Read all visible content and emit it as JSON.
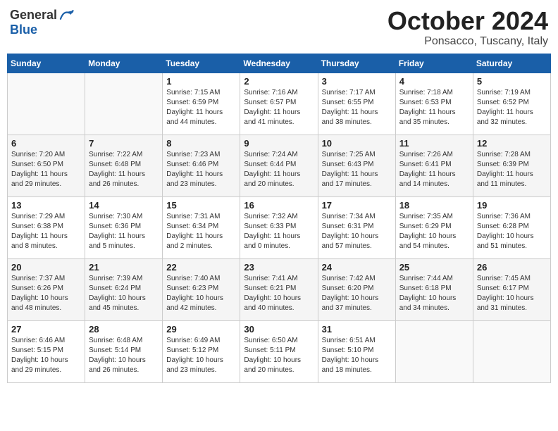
{
  "header": {
    "logo_general": "General",
    "logo_blue": "Blue",
    "month": "October 2024",
    "location": "Ponsacco, Tuscany, Italy"
  },
  "days_of_week": [
    "Sunday",
    "Monday",
    "Tuesday",
    "Wednesday",
    "Thursday",
    "Friday",
    "Saturday"
  ],
  "weeks": [
    [
      {
        "day": "",
        "info": ""
      },
      {
        "day": "",
        "info": ""
      },
      {
        "day": "1",
        "info": "Sunrise: 7:15 AM\nSunset: 6:59 PM\nDaylight: 11 hours and 44 minutes."
      },
      {
        "day": "2",
        "info": "Sunrise: 7:16 AM\nSunset: 6:57 PM\nDaylight: 11 hours and 41 minutes."
      },
      {
        "day": "3",
        "info": "Sunrise: 7:17 AM\nSunset: 6:55 PM\nDaylight: 11 hours and 38 minutes."
      },
      {
        "day": "4",
        "info": "Sunrise: 7:18 AM\nSunset: 6:53 PM\nDaylight: 11 hours and 35 minutes."
      },
      {
        "day": "5",
        "info": "Sunrise: 7:19 AM\nSunset: 6:52 PM\nDaylight: 11 hours and 32 minutes."
      }
    ],
    [
      {
        "day": "6",
        "info": "Sunrise: 7:20 AM\nSunset: 6:50 PM\nDaylight: 11 hours and 29 minutes."
      },
      {
        "day": "7",
        "info": "Sunrise: 7:22 AM\nSunset: 6:48 PM\nDaylight: 11 hours and 26 minutes."
      },
      {
        "day": "8",
        "info": "Sunrise: 7:23 AM\nSunset: 6:46 PM\nDaylight: 11 hours and 23 minutes."
      },
      {
        "day": "9",
        "info": "Sunrise: 7:24 AM\nSunset: 6:44 PM\nDaylight: 11 hours and 20 minutes."
      },
      {
        "day": "10",
        "info": "Sunrise: 7:25 AM\nSunset: 6:43 PM\nDaylight: 11 hours and 17 minutes."
      },
      {
        "day": "11",
        "info": "Sunrise: 7:26 AM\nSunset: 6:41 PM\nDaylight: 11 hours and 14 minutes."
      },
      {
        "day": "12",
        "info": "Sunrise: 7:28 AM\nSunset: 6:39 PM\nDaylight: 11 hours and 11 minutes."
      }
    ],
    [
      {
        "day": "13",
        "info": "Sunrise: 7:29 AM\nSunset: 6:38 PM\nDaylight: 11 hours and 8 minutes."
      },
      {
        "day": "14",
        "info": "Sunrise: 7:30 AM\nSunset: 6:36 PM\nDaylight: 11 hours and 5 minutes."
      },
      {
        "day": "15",
        "info": "Sunrise: 7:31 AM\nSunset: 6:34 PM\nDaylight: 11 hours and 2 minutes."
      },
      {
        "day": "16",
        "info": "Sunrise: 7:32 AM\nSunset: 6:33 PM\nDaylight: 11 hours and 0 minutes."
      },
      {
        "day": "17",
        "info": "Sunrise: 7:34 AM\nSunset: 6:31 PM\nDaylight: 10 hours and 57 minutes."
      },
      {
        "day": "18",
        "info": "Sunrise: 7:35 AM\nSunset: 6:29 PM\nDaylight: 10 hours and 54 minutes."
      },
      {
        "day": "19",
        "info": "Sunrise: 7:36 AM\nSunset: 6:28 PM\nDaylight: 10 hours and 51 minutes."
      }
    ],
    [
      {
        "day": "20",
        "info": "Sunrise: 7:37 AM\nSunset: 6:26 PM\nDaylight: 10 hours and 48 minutes."
      },
      {
        "day": "21",
        "info": "Sunrise: 7:39 AM\nSunset: 6:24 PM\nDaylight: 10 hours and 45 minutes."
      },
      {
        "day": "22",
        "info": "Sunrise: 7:40 AM\nSunset: 6:23 PM\nDaylight: 10 hours and 42 minutes."
      },
      {
        "day": "23",
        "info": "Sunrise: 7:41 AM\nSunset: 6:21 PM\nDaylight: 10 hours and 40 minutes."
      },
      {
        "day": "24",
        "info": "Sunrise: 7:42 AM\nSunset: 6:20 PM\nDaylight: 10 hours and 37 minutes."
      },
      {
        "day": "25",
        "info": "Sunrise: 7:44 AM\nSunset: 6:18 PM\nDaylight: 10 hours and 34 minutes."
      },
      {
        "day": "26",
        "info": "Sunrise: 7:45 AM\nSunset: 6:17 PM\nDaylight: 10 hours and 31 minutes."
      }
    ],
    [
      {
        "day": "27",
        "info": "Sunrise: 6:46 AM\nSunset: 5:15 PM\nDaylight: 10 hours and 29 minutes."
      },
      {
        "day": "28",
        "info": "Sunrise: 6:48 AM\nSunset: 5:14 PM\nDaylight: 10 hours and 26 minutes."
      },
      {
        "day": "29",
        "info": "Sunrise: 6:49 AM\nSunset: 5:12 PM\nDaylight: 10 hours and 23 minutes."
      },
      {
        "day": "30",
        "info": "Sunrise: 6:50 AM\nSunset: 5:11 PM\nDaylight: 10 hours and 20 minutes."
      },
      {
        "day": "31",
        "info": "Sunrise: 6:51 AM\nSunset: 5:10 PM\nDaylight: 10 hours and 18 minutes."
      },
      {
        "day": "",
        "info": ""
      },
      {
        "day": "",
        "info": ""
      }
    ]
  ]
}
